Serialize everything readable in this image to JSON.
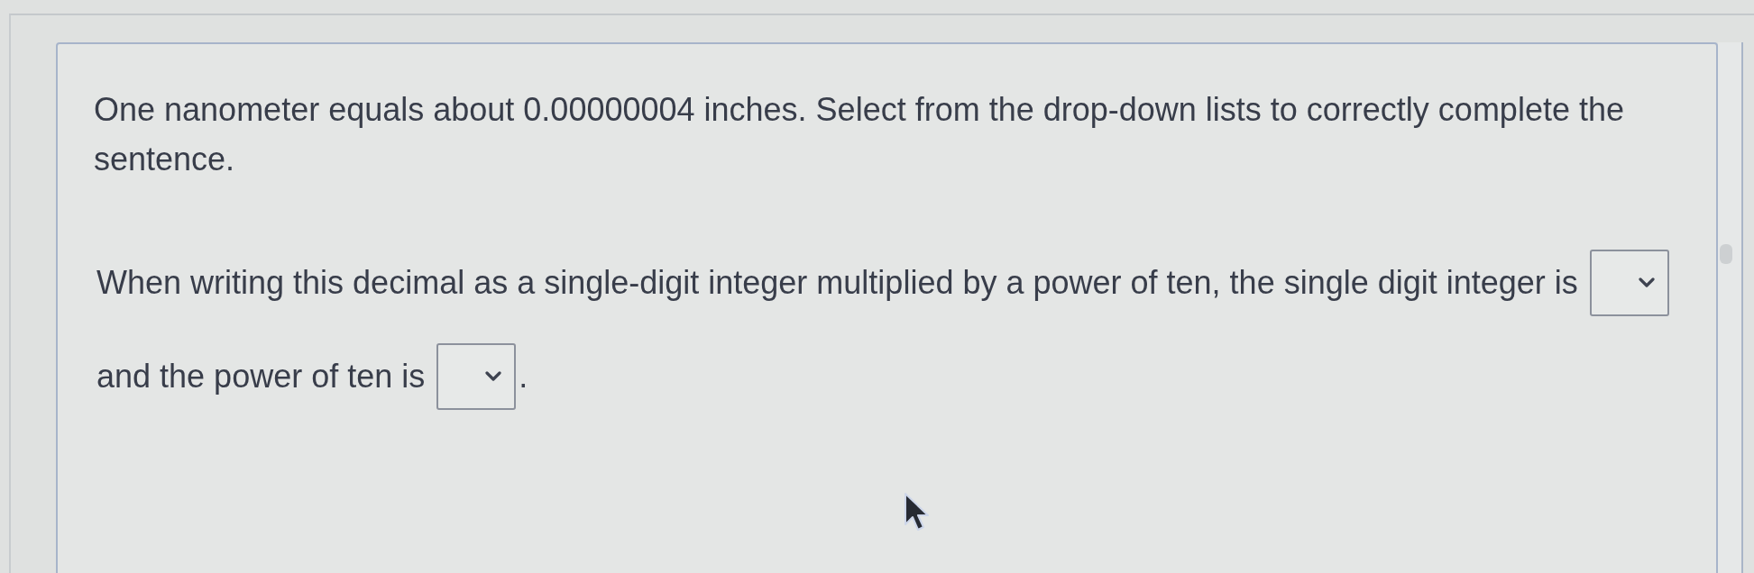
{
  "question": {
    "prompt": "One nanometer equals about 0.00000004 inches. Select from the drop-down lists to correctly complete the sentence.",
    "statement": [
      {
        "kind": "text",
        "text": "When writing this decimal as a single-digit integer multiplied by a power of ten, the single digit integer is"
      },
      {
        "kind": "dropdown"
      },
      {
        "kind": "text",
        "text": "and the power of ten is"
      },
      {
        "kind": "dropdown"
      },
      {
        "kind": "text",
        "text": "."
      }
    ]
  }
}
